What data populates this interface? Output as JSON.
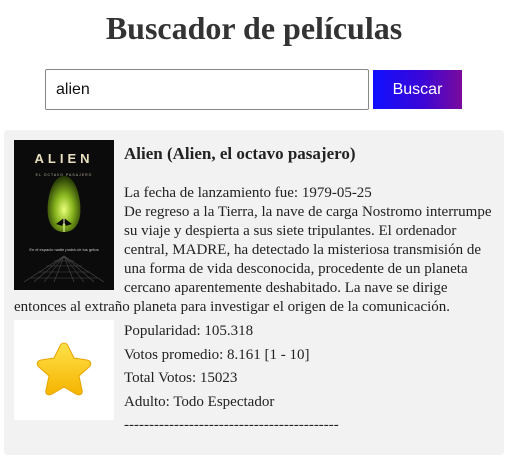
{
  "header": {
    "title": "Buscador de películas"
  },
  "search": {
    "value": "alien",
    "button_label": "Buscar"
  },
  "movie": {
    "title": "Alien (Alien, el octavo pasajero)",
    "release_line": "La fecha de lanzamiento fue: 1979-05-25",
    "overview": "De regreso a la Tierra, la nave de carga Nostromo interrumpe su viaje y despierta a sus siete tripulantes. El ordenador central, MADRE, ha detectado la misteriosa transmisión de una forma de vida desconocida, procedente de un planeta cercano aparentemente deshabitado. La nave se dirige entonces al extraño planeta para investigar el origen de la comunicación.",
    "poster": {
      "title": "ALIEN",
      "subtitle": "EL OCTAVO PASAJERO",
      "tagline": "En el espacio nadie podrá oír tus gritos"
    },
    "popularity": "Popularidad: 105.318",
    "vote_average": "Votos promedio: 8.161 [1 - 10]",
    "vote_count": "Total Votos: 15023",
    "adult": "Adulto: Todo Espectador",
    "separator": "-------------------------------------------",
    "star_icon": "star-icon"
  }
}
